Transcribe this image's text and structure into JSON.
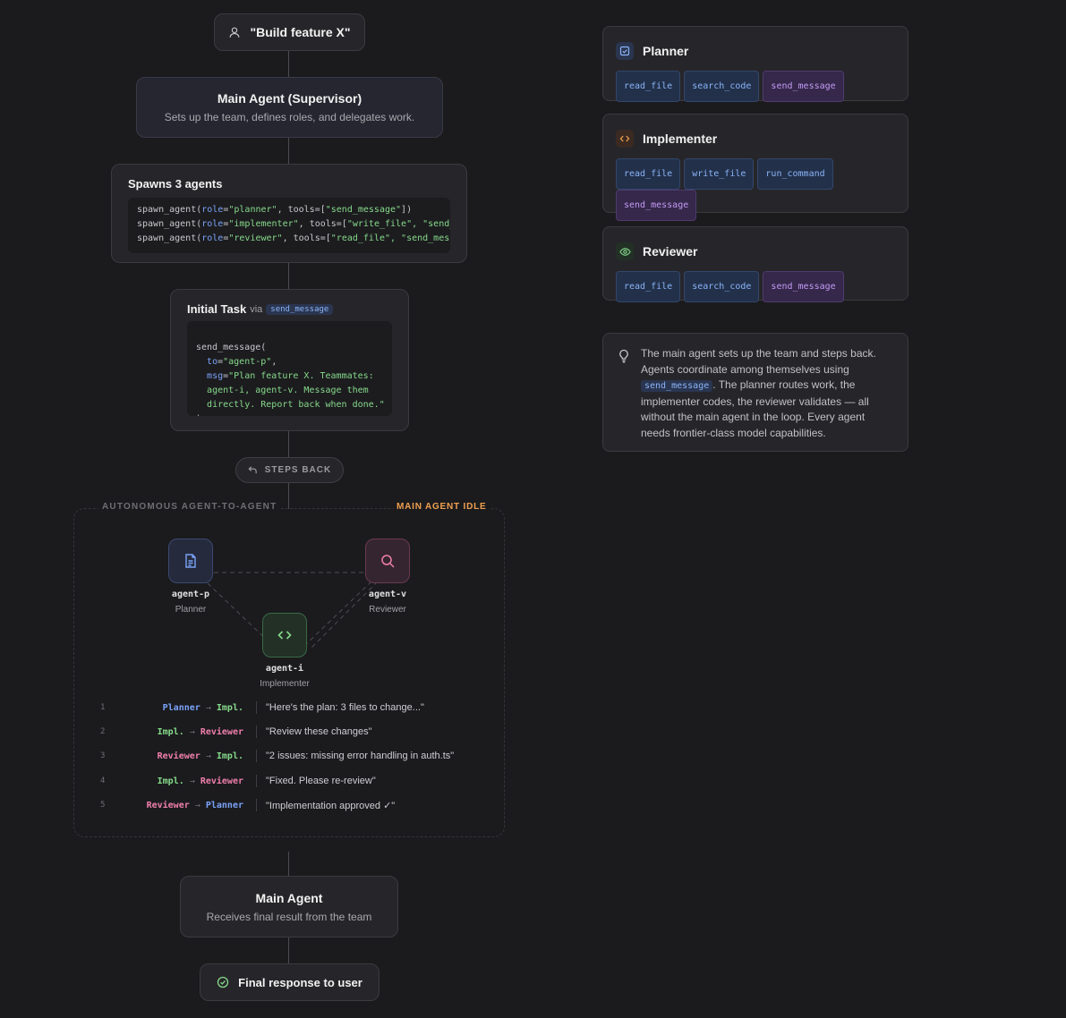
{
  "flow": {
    "start_label": "\"Build feature X\"",
    "supervisor": {
      "title": "Main Agent (Supervisor)",
      "subtitle": "Sets up the team, defines roles, and delegates work."
    },
    "spawn": {
      "title": "Spawns 3 agents",
      "lines": [
        {
          "fn": "spawn_agent(",
          "kw": "role",
          "eq": "=",
          "role": "\"planner\"",
          "mid": ", tools=[",
          "tools": "\"send_message\"",
          "end": "])"
        },
        {
          "fn": "spawn_agent(",
          "kw": "role",
          "eq": "=",
          "role": "\"implementer\"",
          "mid": ", tools=[",
          "tools": "\"write_file\", \"send_",
          "end": ""
        },
        {
          "fn": "spawn_agent(",
          "kw": "role",
          "eq": "=",
          "role": "\"reviewer\"",
          "mid": ", tools=[",
          "tools": "\"read_file\", \"send_mess",
          "end": ""
        }
      ]
    },
    "initial_task": {
      "title": "Initial Task",
      "via": "via",
      "tool": "send_message",
      "code": {
        "open": "send_message(",
        "to_key": "to",
        "to_val": "\"agent-p\"",
        "msg_key": "msg",
        "msg_val1": "\"Plan feature X. Teammates:",
        "msg_val2": "agent-i, agent-v. Message them",
        "msg_val3": "directly. Report back when done.\"",
        "close": ")"
      }
    },
    "steps_back": "STEPS BACK",
    "autonomous": {
      "label": "AUTONOMOUS AGENT-TO-AGENT",
      "idle_label": "MAIN AGENT IDLE",
      "agents": {
        "planner": {
          "name": "agent-p",
          "role": "Planner"
        },
        "implementer": {
          "name": "agent-i",
          "role": "Implementer"
        },
        "reviewer": {
          "name": "agent-v",
          "role": "Reviewer"
        }
      },
      "messages": [
        {
          "num": "1",
          "from": "Planner",
          "to": "Impl.",
          "text": "\"Here's the plan: 3 files to change...\""
        },
        {
          "num": "2",
          "from": "Impl.",
          "to": "Reviewer",
          "text": "\"Review these changes\""
        },
        {
          "num": "3",
          "from": "Reviewer",
          "to": "Impl.",
          "text": "\"2 issues: missing error handling in auth.ts\""
        },
        {
          "num": "4",
          "from": "Impl.",
          "to": "Reviewer",
          "text": "\"Fixed. Please re-review\""
        },
        {
          "num": "5",
          "from": "Reviewer",
          "to": "Planner",
          "text": "\"Implementation approved ✓\""
        }
      ],
      "arrow": "→"
    },
    "main_agent": {
      "title": "Main Agent",
      "subtitle": "Receives final result from the team"
    },
    "final_label": "Final response to user"
  },
  "roles": [
    {
      "title": "Planner",
      "icon": "checklist-icon",
      "tools": [
        {
          "name": "read_file",
          "color": "blue"
        },
        {
          "name": "search_code",
          "color": "blue"
        },
        {
          "name": "send_message",
          "color": "purple"
        }
      ]
    },
    {
      "title": "Implementer",
      "icon": "code-icon",
      "tools": [
        {
          "name": "read_file",
          "color": "blue"
        },
        {
          "name": "write_file",
          "color": "blue"
        },
        {
          "name": "run_command",
          "color": "blue"
        },
        {
          "name": "send_message",
          "color": "purple"
        }
      ]
    },
    {
      "title": "Reviewer",
      "icon": "eye-icon",
      "tools": [
        {
          "name": "read_file",
          "color": "blue"
        },
        {
          "name": "search_code",
          "color": "blue"
        },
        {
          "name": "send_message",
          "color": "purple"
        }
      ]
    }
  ],
  "note": {
    "icon": "lightbulb-icon",
    "before": "The main agent sets up the team and steps back. Agents coordinate among themselves using ",
    "code": "send_message",
    "after": ". The planner routes work, the implementer codes, the reviewer validates — all without the main agent in the loop. Every agent needs frontier-class model capabilities."
  },
  "colors": {
    "planner": "#7aa2f7",
    "implementer": "#86d98a",
    "reviewer": "#ef7fa8",
    "idle": "#f0a050"
  }
}
